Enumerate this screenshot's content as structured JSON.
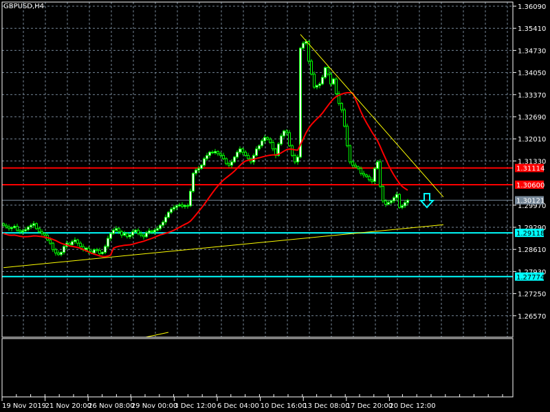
{
  "window": {
    "title": "GBPUSD,H4"
  },
  "chart_data": {
    "type": "candlestick",
    "symbol": "GBPUSD",
    "timeframe": "H4",
    "ylim": [
      1.2625,
      1.362
    ],
    "price_ticks": [
      "1.36090",
      "1.35410",
      "1.34730",
      "1.34050",
      "1.33370",
      "1.32690",
      "1.32010",
      "1.31330",
      "1.29970",
      "1.29290",
      "1.28610",
      "1.27930",
      "1.27250",
      "1.26570"
    ],
    "time_labels": [
      "19 Nov 2019",
      "21 Nov 20:00",
      "26 Nov 08:00",
      "29 Nov 00:00",
      "3 Dec 12:00",
      "6 Dec 04:00",
      "10 Dec 16:00",
      "13 Dec 08:00",
      "17 Dec 20:00",
      "20 Dec 12:00"
    ],
    "closes": [
      1.2935,
      1.293,
      1.2925,
      1.2928,
      1.2932,
      1.292,
      1.2915,
      1.2918,
      1.2922,
      1.293,
      1.2935,
      1.294,
      1.2925,
      1.2915,
      1.291,
      1.2905,
      1.289,
      1.288,
      1.286,
      1.285,
      1.2845,
      1.2852,
      1.287,
      1.288,
      1.2875,
      1.2885,
      1.289,
      1.288,
      1.287,
      1.286,
      1.2865,
      1.2855,
      1.285,
      1.286,
      1.2858,
      1.2848,
      1.2852,
      1.287,
      1.2895,
      1.291,
      1.292,
      1.2925,
      1.2915,
      1.2905,
      1.291,
      1.29,
      1.2905,
      1.2915,
      1.292,
      1.291,
      1.2905,
      1.29,
      1.2912,
      1.2918,
      1.2915,
      1.292,
      1.2925,
      1.2935,
      1.2945,
      1.296,
      1.2975,
      1.2985,
      1.299,
      1.2995,
      1.2998,
      1.2993,
      1.2996,
      1.2995,
      1.304,
      1.3095,
      1.3105,
      1.311,
      1.312,
      1.314,
      1.315,
      1.316,
      1.3158,
      1.3162,
      1.3155,
      1.315,
      1.314,
      1.3125,
      1.312,
      1.313,
      1.3145,
      1.316,
      1.317,
      1.316,
      1.315,
      1.314,
      1.313,
      1.315,
      1.317,
      1.318,
      1.3195,
      1.3205,
      1.32,
      1.319,
      1.317,
      1.315,
      1.3185,
      1.321,
      1.3225,
      1.322,
      1.318,
      1.315,
      1.313,
      1.3145,
      1.348,
      1.3495,
      1.35,
      1.344,
      1.34,
      1.336,
      1.3365,
      1.337,
      1.339,
      1.342,
      1.34,
      1.337,
      1.3385,
      1.334,
      1.331,
      1.329,
      1.324,
      1.318,
      1.313,
      1.312,
      1.3115,
      1.311,
      1.3095,
      1.309,
      1.3085,
      1.3075,
      1.307,
      1.311,
      1.313,
      1.3055,
      1.301,
      1.3,
      1.3005,
      1.301,
      1.302,
      1.303,
      1.299,
      1.2995,
      1.3005,
      1.3012
    ],
    "moving_average_period": 20,
    "horizontal_lines": [
      {
        "price": 1.31114,
        "label": "1.31114",
        "color": "#ff0000"
      },
      {
        "price": 1.306,
        "label": "1.30600",
        "color": "#ff0000"
      },
      {
        "price": 1.30121,
        "label": "1.30121",
        "color": "#778899"
      },
      {
        "price": 1.29118,
        "label": "1.29118",
        "color": "#00ffff"
      },
      {
        "price": 1.27774,
        "label": "1.27774",
        "color": "#00ffff"
      }
    ],
    "trendlines": [
      {
        "from_bar": 0,
        "from_price": 1.2805,
        "to_bar": 160,
        "to_price": 1.2937,
        "color": "#ffff00"
      },
      {
        "from_bar": 108,
        "from_price": 1.3522,
        "to_bar": 160,
        "to_price": 1.3022,
        "color": "#ffff00"
      }
    ],
    "signal": {
      "type": "sell-arrow",
      "color": "#00ffff"
    },
    "colors": {
      "background": "#000000",
      "candle": "#00ff00",
      "bull_body": "#ffffff",
      "bear_body": "#000000",
      "grid": "#778899",
      "ma": "#ff0000",
      "axis": "#ffffff"
    }
  }
}
